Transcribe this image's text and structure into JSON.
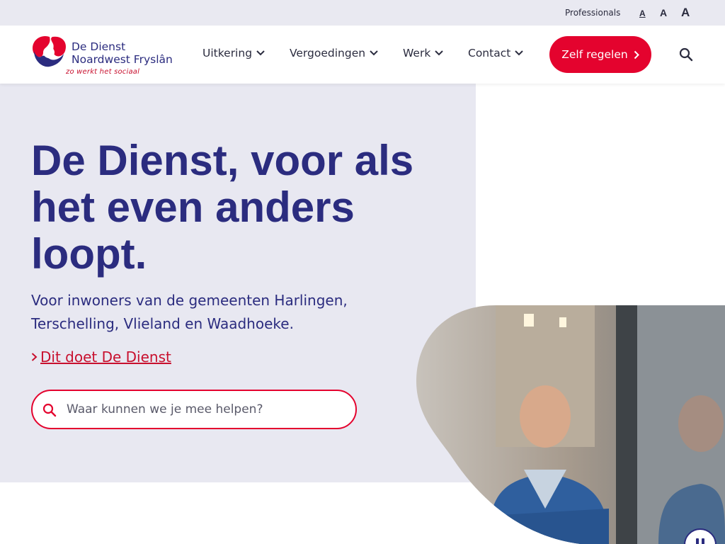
{
  "utility": {
    "professionals": "Professionals",
    "font_small": "A",
    "font_medium": "A",
    "font_large": "A"
  },
  "logo": {
    "line1": "De Dienst",
    "line2": "Noardwest Fryslân",
    "tagline": "zo werkt het sociaal"
  },
  "nav": {
    "items": [
      {
        "label": "Uitkering"
      },
      {
        "label": "Vergoedingen"
      },
      {
        "label": "Werk"
      },
      {
        "label": "Contact"
      }
    ],
    "cta_label": "Zelf regelen"
  },
  "hero": {
    "title": "De Dienst, voor als het even anders loopt.",
    "subtitle": "Voor inwoners van de gemeenten Harlingen, Terschelling, Vlieland en Waadhoeke.",
    "link_label": "Dit doet De Dienst",
    "search_placeholder": "Waar kunnen we je mee helpen?"
  },
  "colors": {
    "brand_blue": "#2b2c7f",
    "brand_red": "#e4032e",
    "hero_bg": "#e8e8f1"
  }
}
